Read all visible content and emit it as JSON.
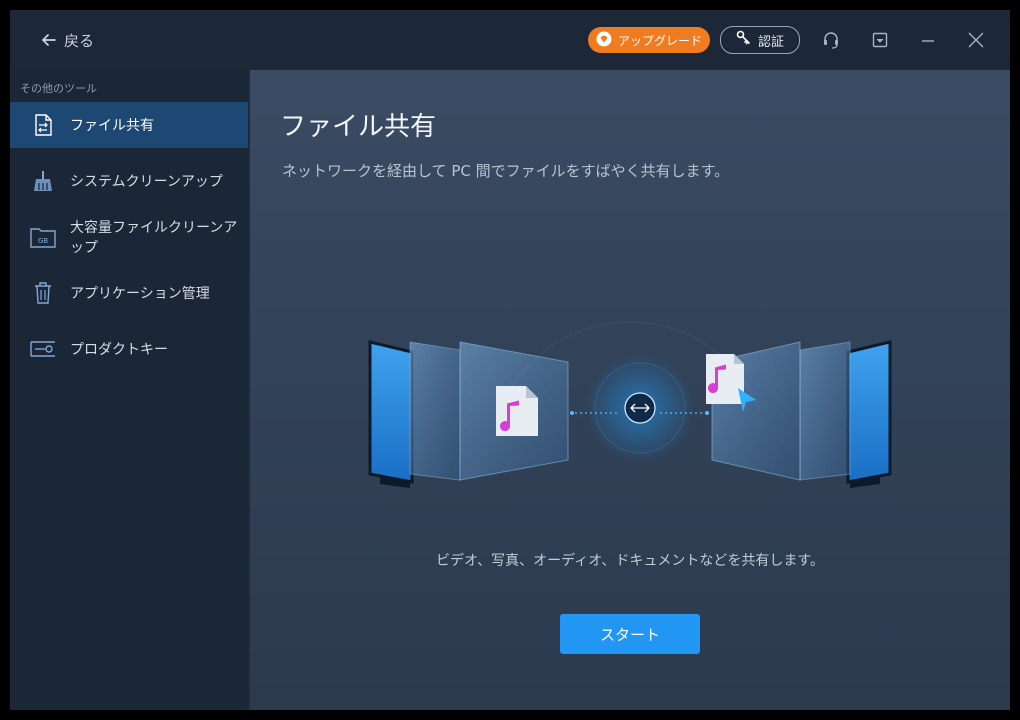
{
  "titlebar": {
    "back_label": "戻る",
    "upgrade_label": "アップグレード",
    "auth_label": "認証"
  },
  "sidebar": {
    "title": "その他のツール",
    "items": [
      {
        "label": "ファイル共有",
        "icon": "file-share-icon",
        "active": true
      },
      {
        "label": "システムクリーンアップ",
        "icon": "broom-icon"
      },
      {
        "label": "大容量ファイルクリーンアップ",
        "icon": "large-file-folder-icon",
        "icon_text": "GB"
      },
      {
        "label": "アプリケーション管理",
        "icon": "trash-icon"
      },
      {
        "label": "プロダクトキー",
        "icon": "key-icon"
      }
    ]
  },
  "main": {
    "title": "ファイル共有",
    "subtitle": "ネットワークを経由して PC 間でファイルをすばやく共有します。",
    "caption": "ビデオ、写真、オーディオ、ドキュメントなどを共有します。",
    "start_label": "スタート"
  },
  "colors": {
    "accent": "#2196f3",
    "upgrade": "#f07c1f",
    "sidebar_active": "#1e4874",
    "music_note": "#d63fd6"
  }
}
